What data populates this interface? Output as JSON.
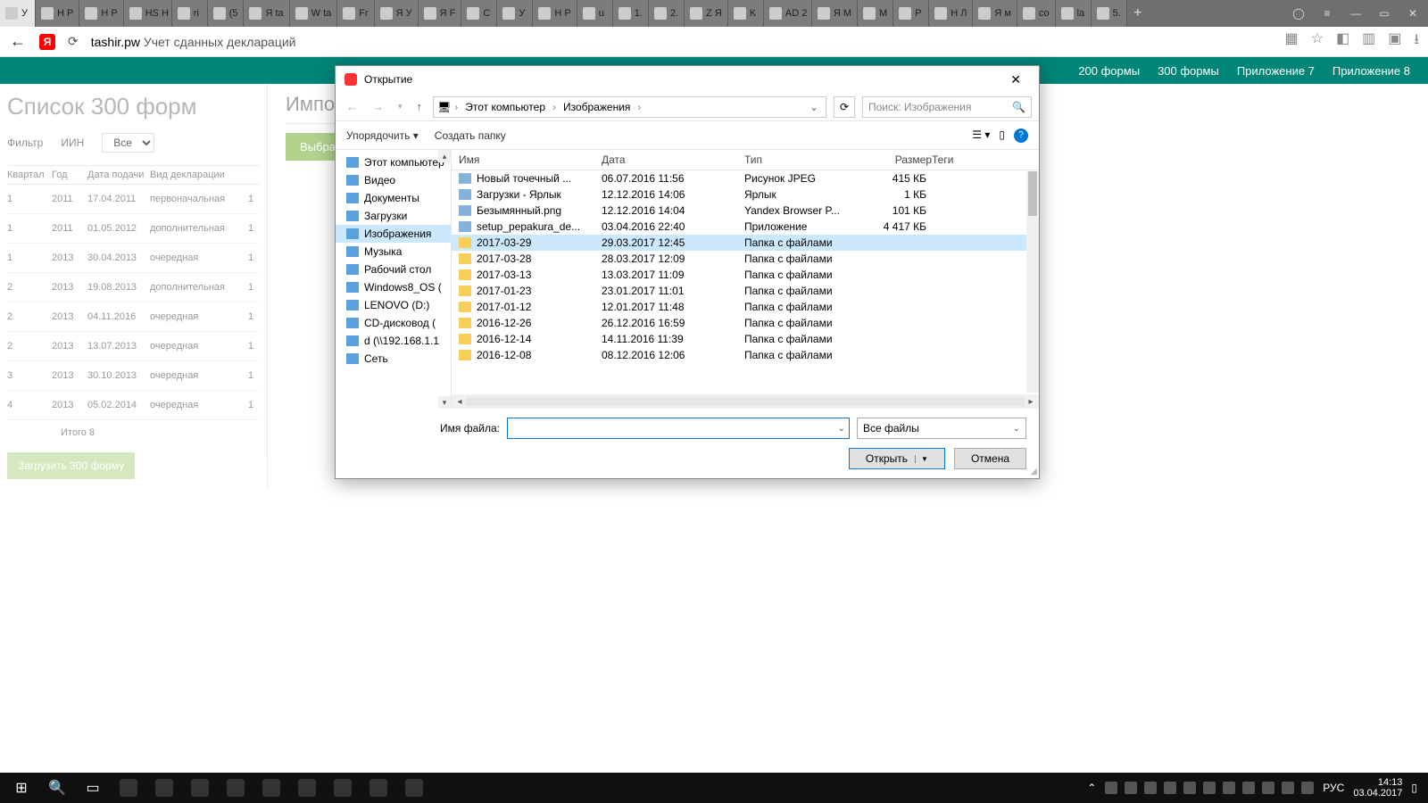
{
  "browser": {
    "tabs": [
      {
        "label": "У"
      },
      {
        "label": "Н P"
      },
      {
        "label": "Н P"
      },
      {
        "label": "HS Н"
      },
      {
        "label": "ri"
      },
      {
        "label": "(5"
      },
      {
        "label": "Я ta"
      },
      {
        "label": "W ta"
      },
      {
        "label": "Fr"
      },
      {
        "label": "Я У"
      },
      {
        "label": "Я F"
      },
      {
        "label": "C"
      },
      {
        "label": "У"
      },
      {
        "label": "Н P"
      },
      {
        "label": "u"
      },
      {
        "label": "1."
      },
      {
        "label": "2."
      },
      {
        "label": "Z Я"
      },
      {
        "label": "K"
      },
      {
        "label": "AD 2"
      },
      {
        "label": "Я М"
      },
      {
        "label": "М"
      },
      {
        "label": "P"
      },
      {
        "label": "Н Л"
      },
      {
        "label": "Я м"
      },
      {
        "label": "co"
      },
      {
        "label": "la"
      },
      {
        "label": "5."
      }
    ],
    "url_domain": "tashir.pw",
    "url_rest": " Учет сданных деклараций"
  },
  "page": {
    "nav_links": [
      "200 формы",
      "300 формы",
      "Приложение 7",
      "Приложение 8"
    ],
    "left_title": "Список 300 форм",
    "filter_label": "Фильтр",
    "iin_label": "ИИН",
    "filter_all": "Все",
    "table_headers": [
      "Квартал",
      "Год",
      "Дата подачи",
      "Вид декларации",
      ""
    ],
    "rows": [
      {
        "q": "1",
        "y": "2011",
        "d": "17.04.2011",
        "t": "первоначальная",
        "c": "1"
      },
      {
        "q": "1",
        "y": "2011",
        "d": "01.05.2012",
        "t": "дополнительная",
        "c": "1"
      },
      {
        "q": "1",
        "y": "2013",
        "d": "30.04.2013",
        "t": "очередная",
        "c": "1"
      },
      {
        "q": "2",
        "y": "2013",
        "d": "19.08.2013",
        "t": "дополнительная",
        "c": "1"
      },
      {
        "q": "2",
        "y": "2013",
        "d": "04.11.2016",
        "t": "очередная",
        "c": "1"
      },
      {
        "q": "2",
        "y": "2013",
        "d": "13.07.2013",
        "t": "очередная",
        "c": "1"
      },
      {
        "q": "3",
        "y": "2013",
        "d": "30.10.2013",
        "t": "очередная",
        "c": "1"
      },
      {
        "q": "4",
        "y": "2013",
        "d": "05.02.2014",
        "t": "очередная",
        "c": "1"
      }
    ],
    "total": "Итого 8",
    "load_button": "Загрузить 300 форму",
    "right_title": "Импор",
    "choose_button": "Выбрат"
  },
  "dialog": {
    "title": "Открытие",
    "breadcrumb": [
      "Этот компьютер",
      "Изображения"
    ],
    "search_placeholder": "Поиск: Изображения",
    "organize": "Упорядочить",
    "new_folder": "Создать папку",
    "tree": [
      {
        "label": "Этот компьютер"
      },
      {
        "label": "Видео"
      },
      {
        "label": "Документы"
      },
      {
        "label": "Загрузки"
      },
      {
        "label": "Изображения",
        "selected": true
      },
      {
        "label": "Музыка"
      },
      {
        "label": "Рабочий стол"
      },
      {
        "label": "Windows8_OS ("
      },
      {
        "label": "LENOVO (D:)"
      },
      {
        "label": "CD-дисковод ("
      },
      {
        "label": "d (\\\\192.168.1.1"
      },
      {
        "label": "Сеть"
      }
    ],
    "columns": [
      "Имя",
      "Дата",
      "Тип",
      "Размер",
      "Теги"
    ],
    "files": [
      {
        "name": "Новый точечный ...",
        "date": "06.07.2016 11:56",
        "type": "Рисунок JPEG",
        "size": "415 КБ",
        "icon": "file"
      },
      {
        "name": "Загрузки - Ярлык",
        "date": "12.12.2016 14:06",
        "type": "Ярлык",
        "size": "1 КБ",
        "icon": "file"
      },
      {
        "name": "Безымянный.png",
        "date": "12.12.2016 14:04",
        "type": "Yandex Browser P...",
        "size": "101 КБ",
        "icon": "file"
      },
      {
        "name": "setup_pepakura_de...",
        "date": "03.04.2016 22:40",
        "type": "Приложение",
        "size": "4 417 КБ",
        "icon": "file"
      },
      {
        "name": "2017-03-29",
        "date": "29.03.2017 12:45",
        "type": "Папка с файлами",
        "size": "",
        "icon": "folder",
        "selected": true
      },
      {
        "name": "2017-03-28",
        "date": "28.03.2017 12:09",
        "type": "Папка с файлами",
        "size": "",
        "icon": "folder"
      },
      {
        "name": "2017-03-13",
        "date": "13.03.2017 11:09",
        "type": "Папка с файлами",
        "size": "",
        "icon": "folder"
      },
      {
        "name": "2017-01-23",
        "date": "23.01.2017 11:01",
        "type": "Папка с файлами",
        "size": "",
        "icon": "folder"
      },
      {
        "name": "2017-01-12",
        "date": "12.01.2017 11:48",
        "type": "Папка с файлами",
        "size": "",
        "icon": "folder"
      },
      {
        "name": "2016-12-26",
        "date": "26.12.2016 16:59",
        "type": "Папка с файлами",
        "size": "",
        "icon": "folder"
      },
      {
        "name": "2016-12-14",
        "date": "14.11.2016 11:39",
        "type": "Папка с файлами",
        "size": "",
        "icon": "folder"
      },
      {
        "name": "2016-12-08",
        "date": "08.12.2016 12:06",
        "type": "Папка с файлами",
        "size": "",
        "icon": "folder"
      }
    ],
    "filename_label": "Имя файла:",
    "filter_value": "Все файлы",
    "open_btn": "Открыть",
    "cancel_btn": "Отмена"
  },
  "taskbar": {
    "lang": "РУС",
    "time": "14:13",
    "date": "03.04.2017",
    "tray_icons": 11,
    "app_icons": 9
  }
}
